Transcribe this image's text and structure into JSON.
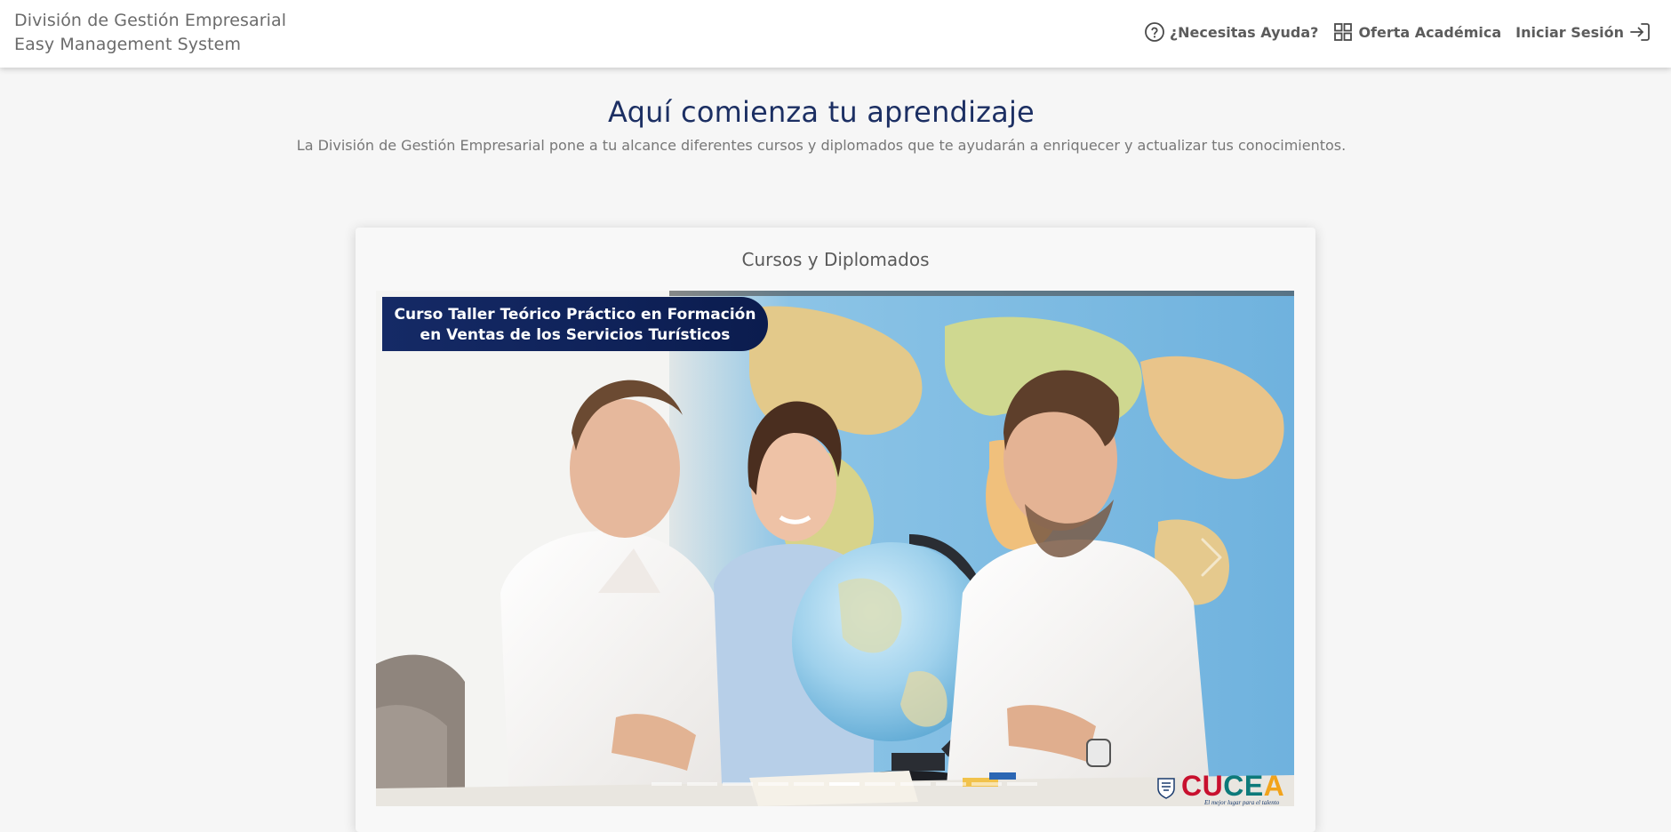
{
  "brand": {
    "line1": "División de Gestión Empresarial",
    "line2": "Easy Management System"
  },
  "nav": {
    "help": {
      "label": "¿Necesitas Ayuda?",
      "icon": "help-circle-icon"
    },
    "offer": {
      "label": "Oferta Académica",
      "icon": "grid-icon"
    },
    "login": {
      "label": "Iniciar Sesión",
      "icon": "login-icon"
    }
  },
  "hero": {
    "title": "Aquí comienza tu aprendizaje",
    "subtitle": "La División de Gestión Empresarial pone a tu alcance diferentes cursos y diplomados que te ayudarán a enriquecer y actualizar tus conocimientos."
  },
  "card": {
    "title": "Cursos y Diplomados"
  },
  "carousel": {
    "slide_label": "Curso Taller Teórico Práctico en Formación en Ventas de los Servicios Turísticos",
    "indicator_count": 11,
    "active_indicator": 5,
    "logo": {
      "text": "CUCEA",
      "tagline": "El mejor lugar para el talento"
    }
  },
  "colors": {
    "title_blue": "#1c2f63",
    "label_navy": "#0f2259",
    "page_bg": "#f6f6f6"
  }
}
